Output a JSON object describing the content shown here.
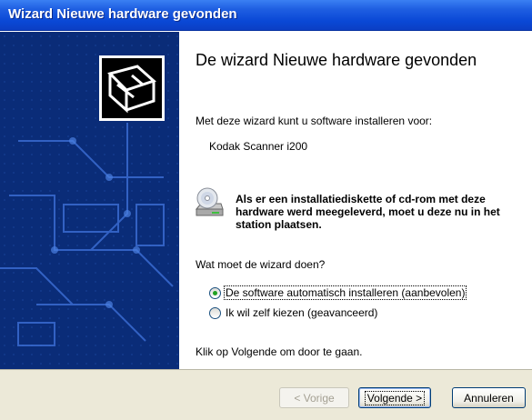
{
  "window": {
    "title": "Wizard Nieuwe hardware gevonden"
  },
  "content": {
    "heading": "De wizard Nieuwe hardware gevonden",
    "intro": "Met deze wizard kunt u software installeren voor:",
    "device_name": "Kodak Scanner i200",
    "cd_note": "Als er een installatiediskette of cd-rom met deze hardware werd meegeleverd, moet u deze nu in het station plaatsen.",
    "question": "Wat moet de wizard doen?",
    "options": [
      {
        "label": "De software automatisch installeren (aanbevolen)",
        "selected": true
      },
      {
        "label": "Ik wil zelf kiezen (geavanceerd)",
        "selected": false
      }
    ],
    "continue_hint": "Klik op Volgende om door te gaan."
  },
  "buttons": {
    "back": "< Vorige",
    "next": "Volgende >",
    "cancel": "Annuleren"
  },
  "icons": {
    "hardware": "hardware-wizard-icon",
    "cd": "cd-drive-icon"
  }
}
